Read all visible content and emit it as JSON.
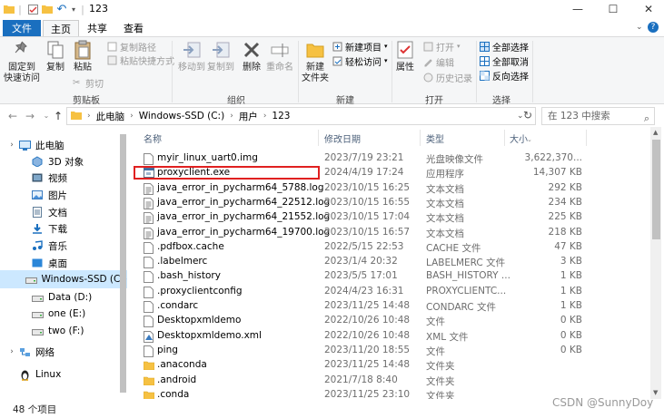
{
  "window": {
    "title": "123"
  },
  "tabs": [
    "文件",
    "主页",
    "共享",
    "查看"
  ],
  "ribbon": {
    "clipboard": {
      "pin": "固定到\n快速访问",
      "copy": "复制",
      "paste": "粘贴",
      "copy_path": "复制路径",
      "paste_shortcut": "粘贴快捷方式",
      "cut": "剪切",
      "label": "剪贴板"
    },
    "organize": {
      "move_to": "移动到",
      "copy_to": "复制到",
      "delete": "删除",
      "rename": "重命名",
      "label": "组织"
    },
    "new": {
      "new_folder": "新建\n文件夹",
      "new_item": "新建项目",
      "easy_access": "轻松访问",
      "label": "新建"
    },
    "open": {
      "properties": "属性",
      "open": "打开",
      "edit": "编辑",
      "history": "历史记录",
      "label": "打开"
    },
    "select": {
      "select_all": "全部选择",
      "select_none": "全部取消",
      "invert": "反向选择",
      "label": "选择"
    }
  },
  "address": {
    "crumbs": [
      "此电脑",
      "Windows-SSD (C:)",
      "用户",
      "123"
    ],
    "search_placeholder": "在 123 中搜索"
  },
  "nav_items": [
    {
      "label": "此电脑",
      "icon": "computer-icon"
    },
    {
      "label": "3D 对象",
      "icon": "3d-objects-icon"
    },
    {
      "label": "视频",
      "icon": "video-icon"
    },
    {
      "label": "图片",
      "icon": "pictures-icon"
    },
    {
      "label": "文档",
      "icon": "documents-icon"
    },
    {
      "label": "下载",
      "icon": "download-icon"
    },
    {
      "label": "音乐",
      "icon": "music-icon"
    },
    {
      "label": "桌面",
      "icon": "desktop-icon"
    },
    {
      "label": "Windows-SSD (C:)",
      "icon": "drive-icon"
    },
    {
      "label": "Data (D:)",
      "icon": "drive-icon"
    },
    {
      "label": "one (E:)",
      "icon": "drive-icon"
    },
    {
      "label": "two (F:)",
      "icon": "drive-icon"
    },
    {
      "label": "网络",
      "icon": "network-icon"
    },
    {
      "label": "Linux",
      "icon": "linux-icon"
    }
  ],
  "columns": {
    "name": "名称",
    "date": "修改日期",
    "type": "类型",
    "size": "大小"
  },
  "files": [
    {
      "name": "myir_linux_uart0.img",
      "date": "2023/7/19 23:21",
      "type": "光盘映像文件",
      "size": "3,622,370...",
      "icon": "file-icon"
    },
    {
      "name": "proxyclient.exe",
      "date": "2024/4/19 17:24",
      "type": "应用程序",
      "size": "14,307 KB",
      "icon": "exe-icon"
    },
    {
      "name": "java_error_in_pycharm64_5788.log",
      "date": "2023/10/15 16:25",
      "type": "文本文档",
      "size": "292 KB",
      "icon": "text-file-icon"
    },
    {
      "name": "java_error_in_pycharm64_22512.log",
      "date": "2023/10/15 16:55",
      "type": "文本文档",
      "size": "234 KB",
      "icon": "text-file-icon"
    },
    {
      "name": "java_error_in_pycharm64_21552.log",
      "date": "2023/10/15 17:04",
      "type": "文本文档",
      "size": "225 KB",
      "icon": "text-file-icon"
    },
    {
      "name": "java_error_in_pycharm64_19700.log",
      "date": "2023/10/15 16:57",
      "type": "文本文档",
      "size": "218 KB",
      "icon": "text-file-icon"
    },
    {
      "name": ".pdfbox.cache",
      "date": "2022/5/15 22:53",
      "type": "CACHE 文件",
      "size": "47 KB",
      "icon": "file-icon"
    },
    {
      "name": ".labelmerc",
      "date": "2023/1/4 20:32",
      "type": "LABELMERC 文件",
      "size": "3 KB",
      "icon": "file-icon"
    },
    {
      "name": ".bash_history",
      "date": "2023/5/5 17:01",
      "type": "BASH_HISTORY ...",
      "size": "1 KB",
      "icon": "file-icon"
    },
    {
      "name": ".proxyclientconfig",
      "date": "2024/4/23 16:31",
      "type": "PROXYCLIENTC...",
      "size": "1 KB",
      "icon": "file-icon"
    },
    {
      "name": ".condarc",
      "date": "2023/11/25 14:48",
      "type": "CONDARC 文件",
      "size": "1 KB",
      "icon": "file-icon"
    },
    {
      "name": "Desktopxmldemo",
      "date": "2022/10/26 10:48",
      "type": "文件",
      "size": "0 KB",
      "icon": "file-icon"
    },
    {
      "name": "Desktopxmldemo.xml",
      "date": "2022/10/26 10:48",
      "type": "XML 文件",
      "size": "0 KB",
      "icon": "xml-file-icon"
    },
    {
      "name": "ping",
      "date": "2023/11/20 18:55",
      "type": "文件",
      "size": "0 KB",
      "icon": "file-icon"
    },
    {
      "name": ".anaconda",
      "date": "2023/11/25 14:48",
      "type": "文件夹",
      "size": "",
      "icon": "folder-icon"
    },
    {
      "name": ".android",
      "date": "2021/7/18 8:40",
      "type": "文件夹",
      "size": "",
      "icon": "folder-icon"
    },
    {
      "name": ".conda",
      "date": "2023/11/25 23:10",
      "type": "文件夹",
      "size": "",
      "icon": "folder-icon"
    }
  ],
  "status": {
    "count": "48 个项目"
  },
  "watermark": "CSDN @SunnyDoy",
  "colors": {
    "accent": "#1a6fbf",
    "selection": "#cce8ff",
    "highlight_box": "#e02020",
    "folder": "#f6c142"
  }
}
